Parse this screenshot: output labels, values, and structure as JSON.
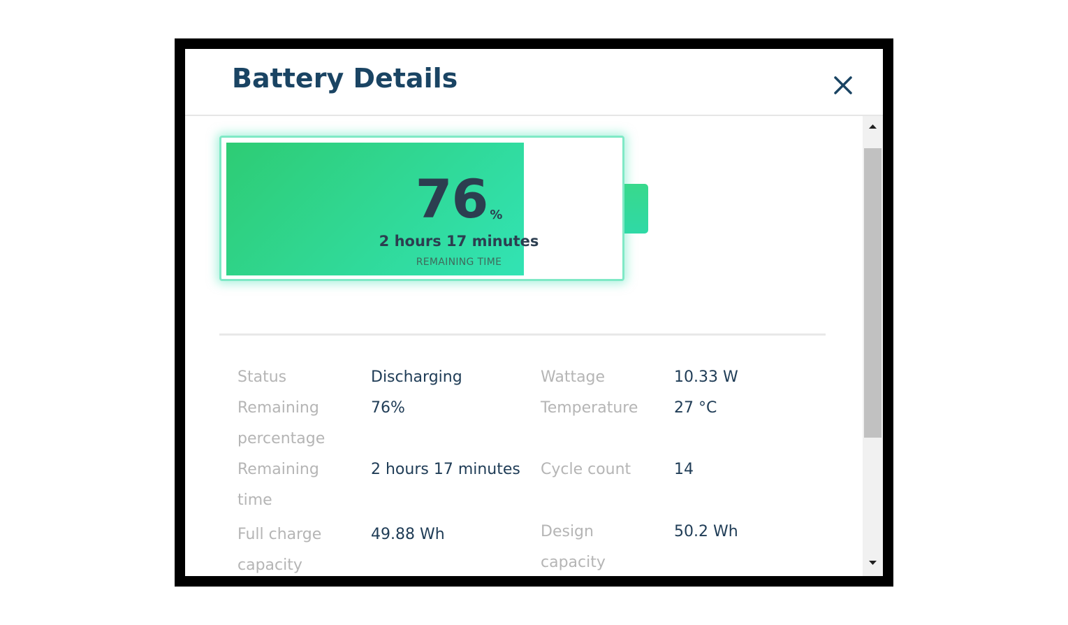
{
  "dialog": {
    "title": "Battery Details",
    "close_icon": "close-icon"
  },
  "battery": {
    "percent": 76,
    "percent_text": "76",
    "percent_unit": "%",
    "remaining_time": "2 hours 17 minutes",
    "remaining_label": "REMAINING TIME",
    "colors": {
      "fill_start": "#2ecc74",
      "fill_end": "#32e3b4",
      "outline": "#7fe9c6"
    }
  },
  "details": {
    "left": [
      {
        "label_lines": [
          "Status"
        ],
        "value": "Discharging"
      },
      {
        "label_lines": [
          "Remaining",
          "percentage"
        ],
        "value": "76%"
      },
      {
        "label_lines": [
          "Remaining",
          "time"
        ],
        "value": "2 hours 17 minutes"
      },
      {
        "label_lines": [
          "Full charge",
          "capacity"
        ],
        "value": "49.88 Wh"
      }
    ],
    "right": [
      {
        "label_lines": [
          "Wattage"
        ],
        "value": "10.33 W"
      },
      {
        "label_lines": [
          "Temperature"
        ],
        "value": "27 °C"
      },
      {
        "label_lines": [
          "Cycle count"
        ],
        "value": "14"
      },
      {
        "label_lines": [
          "Design",
          "capacity"
        ],
        "value": "50.2 Wh"
      }
    ]
  },
  "scrollbar": {
    "up_icon": "scroll-up-arrow-icon",
    "down_icon": "scroll-down-arrow-icon"
  }
}
